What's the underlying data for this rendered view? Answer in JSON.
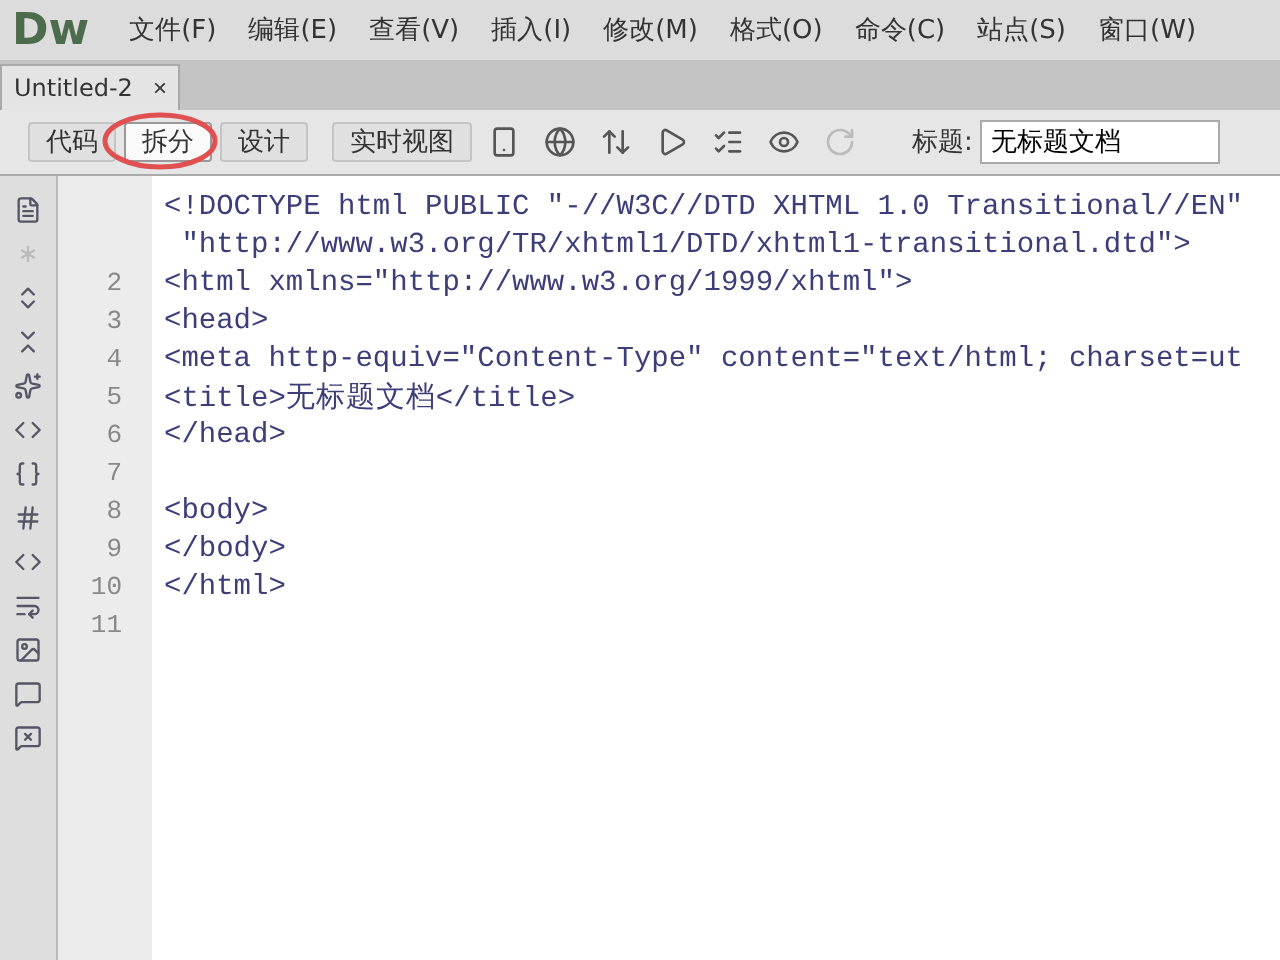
{
  "app": {
    "logo": "Dw",
    "menu": [
      "文件(F)",
      "编辑(E)",
      "查看(V)",
      "插入(I)",
      "修改(M)",
      "格式(O)",
      "命令(C)",
      "站点(S)",
      "窗口(W)"
    ]
  },
  "document_tab": {
    "label": "Untitled-2",
    "close": "×"
  },
  "view_buttons": [
    {
      "label": "代码",
      "selected": false
    },
    {
      "label": "拆分",
      "selected": true
    },
    {
      "label": "设计",
      "selected": false
    },
    {
      "label": "实时视图",
      "selected": false
    }
  ],
  "title_field": {
    "label": "标题:",
    "value": "无标题文档"
  },
  "editor": {
    "lines": [
      {
        "text": "<!DOCTYPE html PUBLIC \"-//W3C//DTD XHTML 1.0 Transitional//EN\""
      },
      {
        "text": " \"http://www.w3.org/TR/xhtml1/DTD/xhtml1-transitional.dtd\">"
      },
      {
        "number": "2",
        "text": "<html xmlns=\"http://www.w3.org/1999/xhtml\">"
      },
      {
        "number": "3",
        "text": "<head>"
      },
      {
        "number": "4",
        "text": "<meta http-equiv=\"Content-Type\" content=\"text/html; charset=ut"
      },
      {
        "number": "5",
        "text": "<title>无标题文档</title>"
      },
      {
        "number": "6",
        "text": "</head>"
      },
      {
        "number": "7"
      },
      {
        "number": "8",
        "text": "<body>"
      },
      {
        "number": "9",
        "text": "</body>"
      },
      {
        "number": "10",
        "text": "</html>"
      },
      {
        "number": "11"
      }
    ]
  }
}
